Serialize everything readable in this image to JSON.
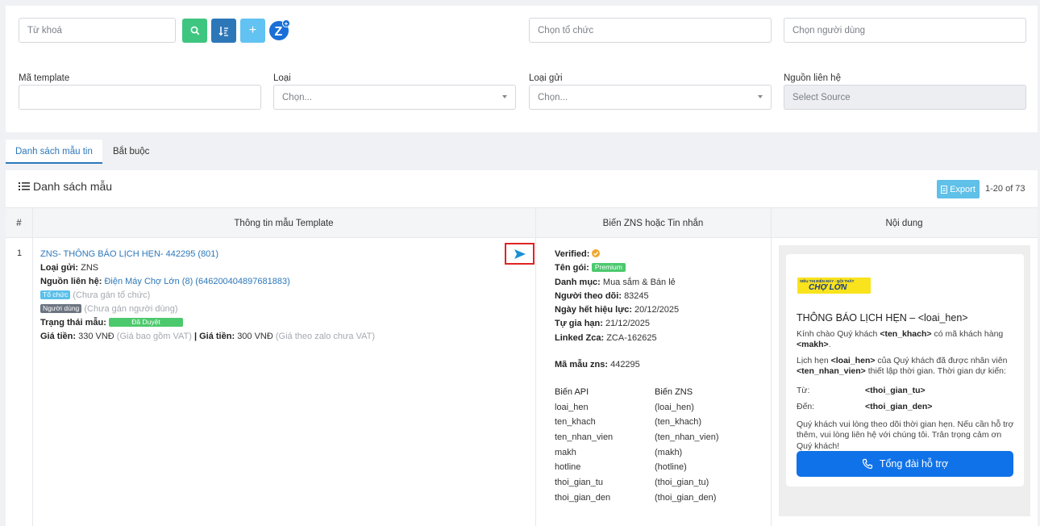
{
  "filters": {
    "keyword_placeholder": "Từ khoá",
    "org_placeholder": "Chọn tổ chức",
    "user_placeholder": "Chọn người dùng",
    "template_code_label": "Mã template",
    "type_label": "Loại",
    "type_placeholder": "Chọn...",
    "send_type_label": "Loại gửi",
    "send_type_placeholder": "Chọn...",
    "source_label": "Nguồn liên hệ",
    "source_placeholder": "Select Source"
  },
  "toolbar": {
    "search_icon": "search-icon",
    "sort_icon": "sort-icon",
    "add_icon": "plus-icon",
    "zalo_icon": "zalo-icon",
    "colors": {
      "search": "#3ec680",
      "sort": "#2d77b9",
      "add": "#62c3f2"
    }
  },
  "tabs": [
    {
      "label": "Danh sách mẫu tin",
      "active": true
    },
    {
      "label": "Bắt buộc",
      "active": false
    }
  ],
  "list": {
    "title": "Danh sách mẫu",
    "export_label": "Export",
    "pagination": "1-20 of 73",
    "columns": [
      "#",
      "Thông tin mẫu Template",
      "Biến ZNS hoặc Tin nhắn",
      "Nội dung"
    ]
  },
  "row": {
    "index": "1",
    "name": "ZNS- THÔNG BÁO LỊCH HẸN- 442295 (801)",
    "send_type_label": "Loại gửi:",
    "send_type": "ZNS",
    "source_label": "Nguồn liên hệ:",
    "source": "Điện Máy Chợ Lớn (8) (646200404897681883)",
    "org_tag": "Tổ chức",
    "org_value": "(Chưa gán tổ chức)",
    "user_tag": "Người dùng",
    "user_value": "(Chưa gán người dùng)",
    "status_label": "Trạng thái mẫu:",
    "status": "Đã Duyệt",
    "price_label_1": "Giá tiền:",
    "price_1": "330 VNĐ",
    "price_note_1": "(Giá bao gồm VAT)",
    "separator": "|",
    "price_label_2": "Giá tiền:",
    "price_2": "300 VNĐ",
    "price_note_2": "(Giá theo zalo chưa VAT)",
    "send_icon": "send-arrow-icon"
  },
  "zns": {
    "verified_label": "Verified:",
    "package_label": "Tên gói:",
    "package": "Premium",
    "category_label": "Danh mục:",
    "category": "Mua sắm & Bán lẻ",
    "followers_label": "Người theo dõi:",
    "followers": "83245",
    "expiry_label": "Ngày hết hiệu lực:",
    "expiry": "20/12/2025",
    "renew_label": "Tự gia hạn:",
    "renew": "21/12/2025",
    "linked_label": "Linked Zca:",
    "linked": "ZCA-162625",
    "code_label": "Mã mẫu zns:",
    "code": "442295",
    "var_header_api": "Biến API",
    "var_header_zns": "Biến ZNS",
    "variables": [
      {
        "api": "loai_hen",
        "zns": "(loai_hen)"
      },
      {
        "api": "ten_khach",
        "zns": "(ten_khach)"
      },
      {
        "api": "ten_nhan_vien",
        "zns": "(ten_nhan_vien)"
      },
      {
        "api": "makh",
        "zns": "(makh)"
      },
      {
        "api": "hotline",
        "zns": "(hotline)"
      },
      {
        "api": "thoi_gian_tu",
        "zns": "(thoi_gian_tu)"
      },
      {
        "api": "thoi_gian_den",
        "zns": "(thoi_gian_den)"
      }
    ]
  },
  "preview": {
    "logo_top": "SIÊU THỊ ĐIỆN MÁY - NỘI THẤT",
    "logo_main": "CHỢ LỚN",
    "title": "THÔNG BÁO LỊCH HẸN – <loai_hen>",
    "p1_a": "Kính chào Quý khách ",
    "p1_b": "<ten_khach>",
    "p1_c": " có mã khách hàng ",
    "p1_d": "<makh>",
    "p1_e": ".",
    "p2_a": "Lịch hẹn ",
    "p2_b": "<loai_hen>",
    "p2_c": " của Quý khách đã được nhân viên ",
    "p2_d": "<ten_nhan_vien>",
    "p2_e": " thiết lập thời gian. Thời gian dự kiến:",
    "from_label": "Từ:",
    "from_value": "<thoi_gian_tu>",
    "to_label": "Đến:",
    "to_value": "<thoi_gian_den>",
    "p3": "Quý khách vui lòng theo dõi thời gian hẹn. Nếu cần hỗ trợ thêm, vui lòng liên hệ với chúng tôi. Trân trọng cảm ơn Quý khách!",
    "button_label": "Tổng đài hỗ trợ",
    "button_icon": "phone-icon",
    "button_color": "#1072e8"
  }
}
